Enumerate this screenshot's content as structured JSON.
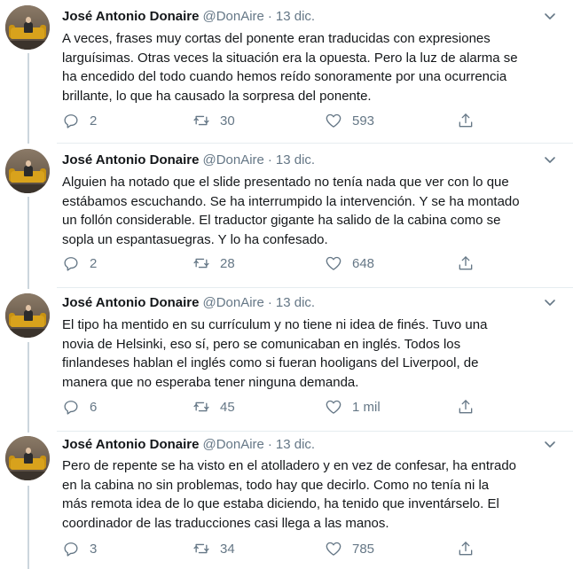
{
  "author": {
    "name": "José Antonio Donaire",
    "handle": "@DonAire",
    "separator": "·"
  },
  "icons": {
    "reply": "reply-icon",
    "retweet": "retweet-icon",
    "like": "heart-icon",
    "share": "share-icon",
    "more": "chevron-down-icon"
  },
  "colors": {
    "text": "#14171a",
    "secondary": "#657786",
    "thread_line": "#ccd6dd",
    "divider": "#e6ecf0"
  },
  "tweets": [
    {
      "date": "13 dic.",
      "lines": [
        "A veces, frases muy cortas del ponente eran traducidas con expresiones",
        "larguísimas. Otras veces la situación era la opuesta. Pero la luz de alarma se",
        "ha encedido del todo cuando hemos reído sonoramente por una ocurrencia",
        "brillante, lo que ha causado la sorpresa del ponente."
      ],
      "replies": "2",
      "retweets": "30",
      "likes": "593"
    },
    {
      "date": "13 dic.",
      "lines": [
        "Alguien ha notado que el slide presentado no tenía nada que ver con lo que",
        "estábamos escuchando. Se ha interrumpido la intervención. Y se ha montado",
        "un follón considerable. El traductor gigante ha salido de la cabina como se",
        "sopla un espantasuegras. Y lo ha confesado."
      ],
      "replies": "2",
      "retweets": "28",
      "likes": "648"
    },
    {
      "date": "13 dic.",
      "lines": [
        "El tipo ha mentido en su currículum y no tiene ni idea de finés. Tuvo una",
        "novia de Helsinki, eso sí, pero se comunicaban en inglés. Todos los",
        "finlandeses hablan el inglés como si fueran hooligans del Liverpool, de",
        "manera que no esperaba tener ninguna demanda."
      ],
      "replies": "6",
      "retweets": "45",
      "likes": "1 mil"
    },
    {
      "date": "13 dic.",
      "lines": [
        "Pero de repente se ha visto en el atolladero y en vez de confesar, ha entrado",
        "en la cabina no sin problemas, todo hay que decirlo. Como no tenía ni la",
        "más remota idea de lo que estaba diciendo, ha tenido que inventárselo. El",
        "coordinador de las traducciones casi llega a las manos."
      ],
      "replies": "3",
      "retweets": "34",
      "likes": "785"
    }
  ]
}
